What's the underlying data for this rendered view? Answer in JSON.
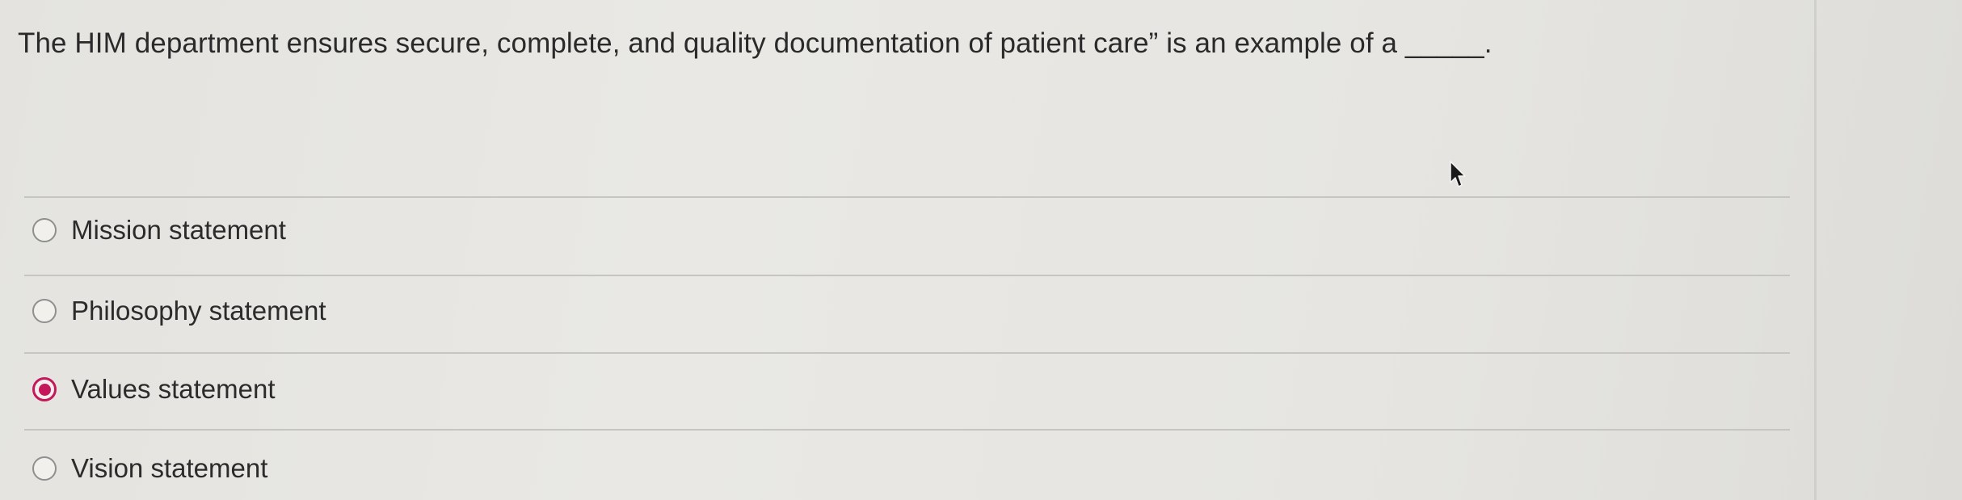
{
  "question": {
    "text": "The HIM department ensures secure, complete, and quality documentation of patient care” is an example of a _____."
  },
  "options": [
    {
      "label": "Mission statement",
      "selected": false
    },
    {
      "label": "Philosophy statement",
      "selected": false
    },
    {
      "label": "Values statement",
      "selected": true
    },
    {
      "label": "Vision statement",
      "selected": false
    }
  ],
  "colors": {
    "selected_radio": "#c4185a",
    "background": "#e7e6e2"
  },
  "icons": {
    "cursor": "mouse-pointer-icon"
  }
}
